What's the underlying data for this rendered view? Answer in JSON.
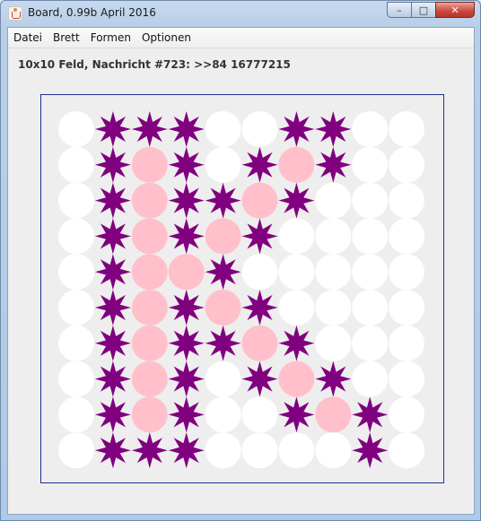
{
  "window": {
    "title": "Board, 0.99b April 2016",
    "buttons": {
      "minimize": "–",
      "maximize": "□",
      "close": "✕"
    }
  },
  "menu": [
    "Datei",
    "Brett",
    "Formen",
    "Optionen"
  ],
  "status": "10x10 Feld, Nachricht #723: >>84 16777215",
  "colors": {
    "circle": "#ffffff",
    "pink": "#ffc0cb",
    "star": "#800080",
    "frame": "#1f2f8c"
  },
  "board": {
    "size": 10,
    "legend": {
      "c": "white-circle",
      "p": "pink-circle",
      "s": "purple-star"
    },
    "rows": [
      "csssccsscc",
      "cspscspscc",
      "cspsspsccc",
      "cspspscccc",
      "csppsccccc",
      "cspspscccc",
      "cspsspsccc",
      "cspscspscc",
      "cspsccspsc",
      "csssccccsc"
    ]
  }
}
